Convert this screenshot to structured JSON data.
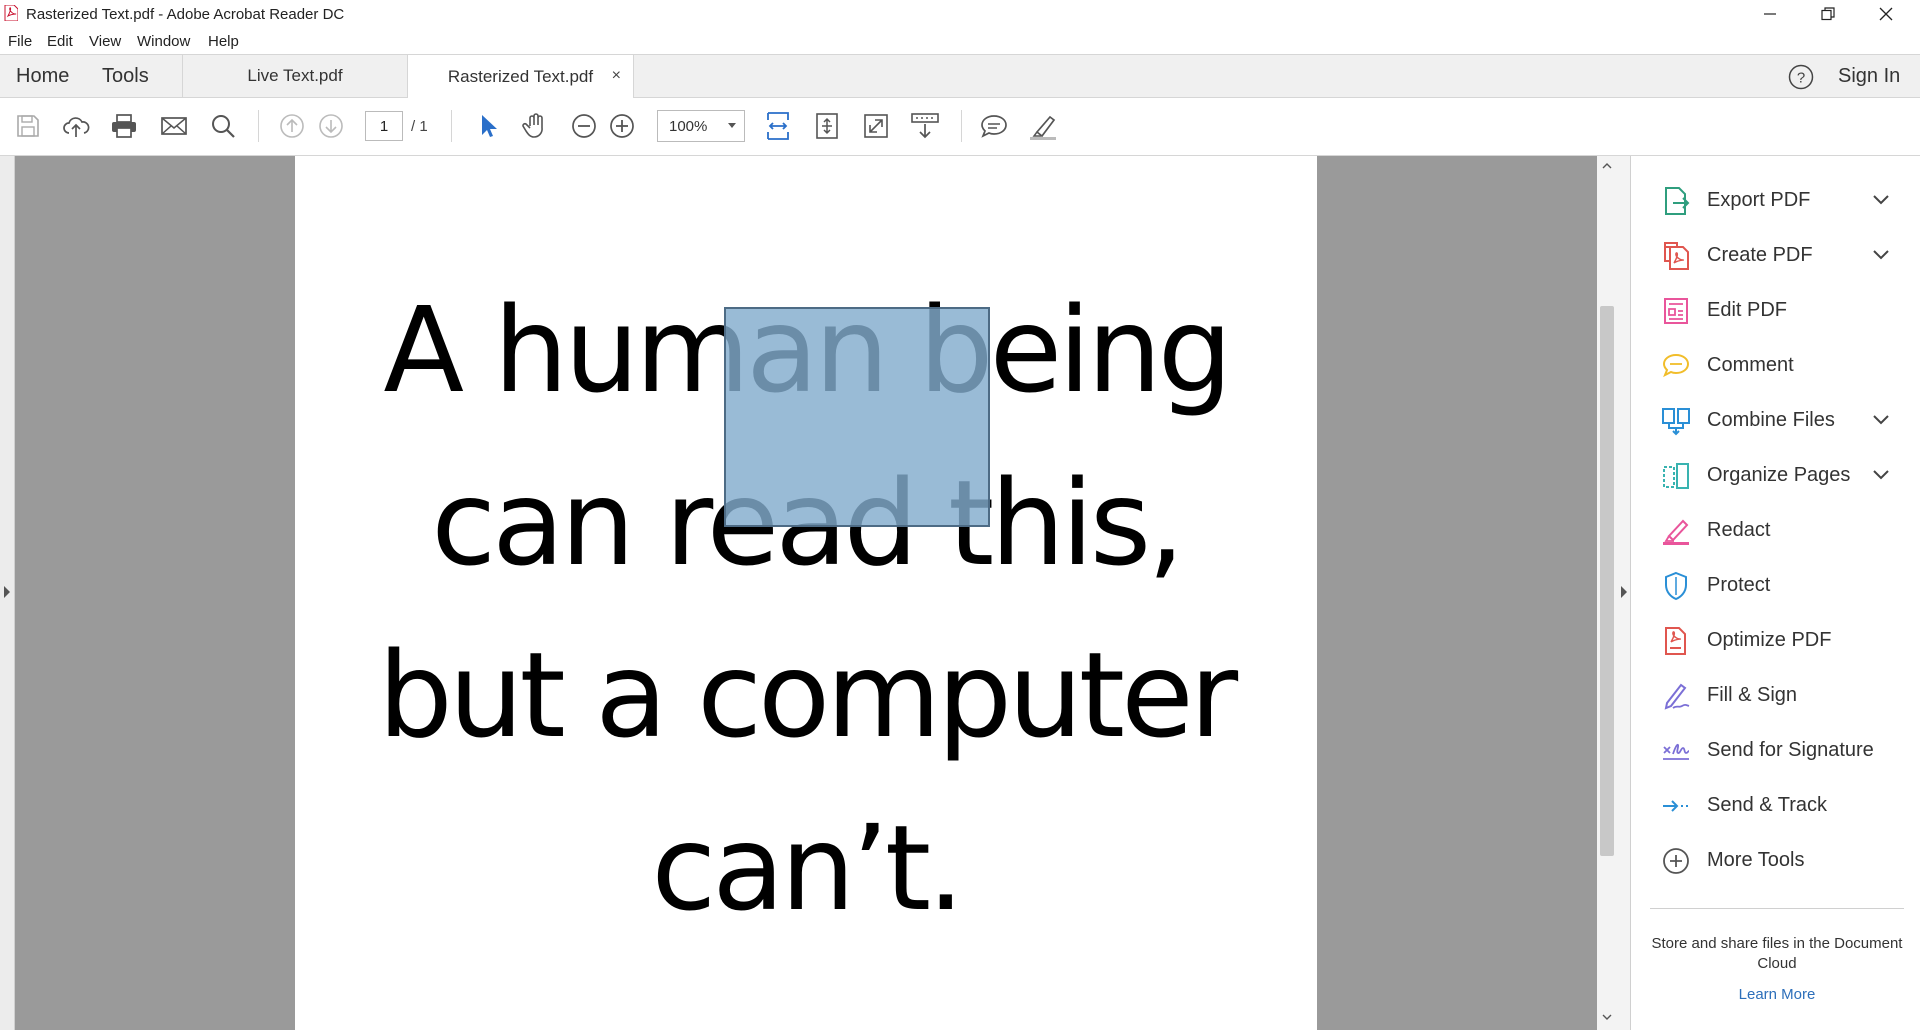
{
  "window": {
    "title": "Rasterized Text.pdf - Adobe Acrobat Reader DC",
    "controls": [
      "minimize-icon",
      "restore-icon",
      "close-icon"
    ]
  },
  "menu": [
    "File",
    "Edit",
    "View",
    "Window",
    "Help"
  ],
  "tabs": {
    "home": "Home",
    "tools": "Tools",
    "documents": [
      {
        "label": "Live Text.pdf",
        "active": false
      },
      {
        "label": "Rasterized Text.pdf",
        "active": true,
        "close": "×"
      }
    ],
    "help_icon": "help-icon",
    "sign_in": "Sign In"
  },
  "toolbar": {
    "icons": [
      "save-icon",
      "cloud-upload-icon",
      "print-icon",
      "email-icon",
      "search-icon",
      "previous-page-icon",
      "next-page-icon",
      "select-tool-icon",
      "hand-tool-icon",
      "zoom-out-icon",
      "zoom-in-icon",
      "fit-width-icon",
      "fit-page-icon",
      "full-screen-icon",
      "read-mode-icon",
      "comment-icon",
      "highlight-pen-icon"
    ],
    "page_current": "1",
    "page_total": "/ 1",
    "zoom": "100%"
  },
  "document": {
    "lines": [
      "A human being",
      "can read this,",
      "but a computer",
      "can’t."
    ]
  },
  "right_pane": {
    "tools": [
      {
        "label": "Export PDF",
        "icon": "export-pdf-icon",
        "color": "#2f9e7e",
        "expandable": true
      },
      {
        "label": "Create PDF",
        "icon": "create-pdf-icon",
        "color": "#e0564f",
        "expandable": true
      },
      {
        "label": "Edit PDF",
        "icon": "edit-pdf-icon",
        "color": "#e9559b",
        "expandable": false
      },
      {
        "label": "Comment",
        "icon": "comment-icon",
        "color": "#f1bd2a",
        "expandable": false
      },
      {
        "label": "Combine Files",
        "icon": "combine-files-icon",
        "color": "#2a8fd6",
        "expandable": true
      },
      {
        "label": "Organize Pages",
        "icon": "organize-pages-icon",
        "color": "#39b3b0",
        "expandable": true
      },
      {
        "label": "Redact",
        "icon": "redact-icon",
        "color": "#e9559b",
        "expandable": false
      },
      {
        "label": "Protect",
        "icon": "protect-icon",
        "color": "#2a8fd6",
        "expandable": false
      },
      {
        "label": "Optimize PDF",
        "icon": "optimize-pdf-icon",
        "color": "#e0564f",
        "expandable": false
      },
      {
        "label": "Fill & Sign",
        "icon": "fill-sign-icon",
        "color": "#7b6fd6",
        "expandable": false
      },
      {
        "label": "Send for Signature",
        "icon": "send-for-signature-icon",
        "color": "#7b6fd6",
        "expandable": false
      },
      {
        "label": "Send & Track",
        "icon": "send-track-icon",
        "color": "#2a8fd6",
        "expandable": false
      },
      {
        "label": "More Tools",
        "icon": "more-tools-icon",
        "color": "#555555",
        "expandable": false
      }
    ],
    "cloud_text": "Store and share files in the Document Cloud",
    "learn_more": "Learn More"
  }
}
